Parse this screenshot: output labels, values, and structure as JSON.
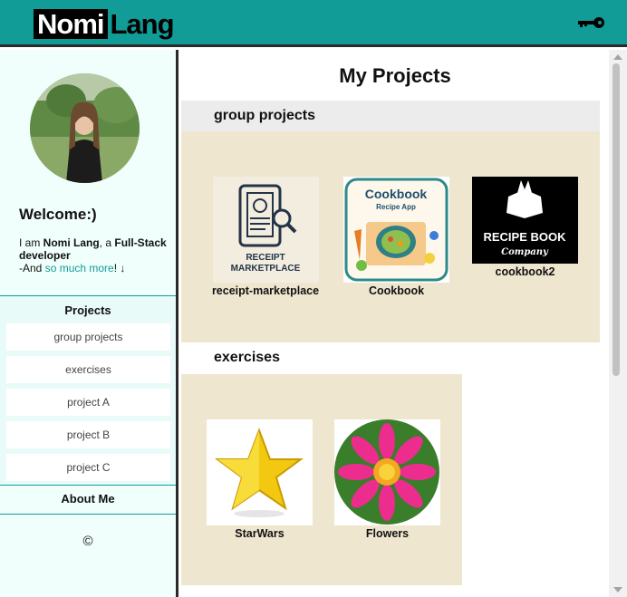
{
  "header": {
    "logo_first": "Nomi",
    "logo_last": "Lang",
    "key_icon": "key-icon"
  },
  "sidebar": {
    "welcome": "Welcome:)",
    "intro_1": "I am ",
    "intro_name": "Nomi Lang",
    "intro_2": ", a ",
    "intro_role": "Full-Stack developer",
    "intro_3": "-And ",
    "intro_link": "so much more",
    "intro_4": "! ↓",
    "nav_heading": "Projects",
    "nav_items": [
      {
        "label": "group projects"
      },
      {
        "label": "exercises"
      },
      {
        "label": "project A"
      },
      {
        "label": "project B"
      },
      {
        "label": "project C"
      }
    ],
    "about": "About Me",
    "copyright": "©"
  },
  "main": {
    "title": "My Projects",
    "sections": [
      {
        "heading": "group projects",
        "cards": [
          {
            "label": "receipt-marketplace",
            "image_text_1": "RECEIPT",
            "image_text_2": "MARKETPLACE"
          },
          {
            "label": "Cookbook",
            "image_text_1": "Cookbook",
            "image_text_2": "Recipe App"
          },
          {
            "label": "cookbook2",
            "image_text_1": "RECIPE BOOK",
            "image_text_2": "Company"
          }
        ]
      },
      {
        "heading": "exercises",
        "cards": [
          {
            "label": "StarWars"
          },
          {
            "label": "Flowers"
          }
        ]
      }
    ]
  },
  "colors": {
    "header_teal": "#119c98",
    "sidebar_bg": "#f0fffb",
    "card_bg": "#efe6cf",
    "section_head_bg": "#ececec",
    "link": "#119c98"
  }
}
